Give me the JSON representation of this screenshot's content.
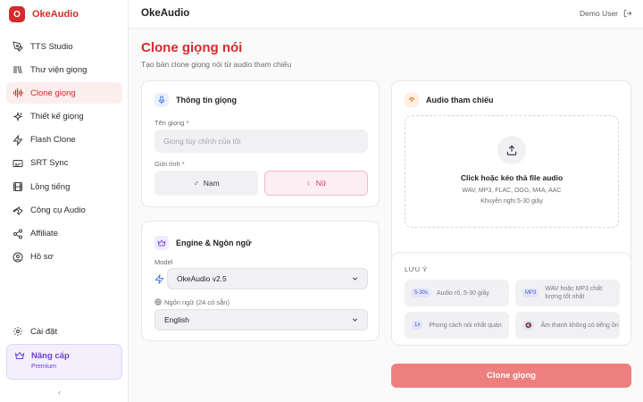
{
  "brand": {
    "logo_letter": "O",
    "name": "OkeAudio",
    "color": "#d42b2b"
  },
  "sidebar": {
    "items": [
      {
        "label": "TTS Studio",
        "icon": "pen-nib-icon"
      },
      {
        "label": "Thư viện giọng",
        "icon": "library-icon"
      },
      {
        "label": "Clone giọng",
        "icon": "waveform-icon",
        "active": true
      },
      {
        "label": "Thiết kế giọng",
        "icon": "sparkles-icon"
      },
      {
        "label": "Flash Clone",
        "icon": "lightning-icon"
      },
      {
        "label": "SRT Sync",
        "icon": "subtitles-icon"
      },
      {
        "label": "Lồng tiếng",
        "icon": "film-icon"
      },
      {
        "label": "Công cụ Audio",
        "icon": "wrench-icon"
      },
      {
        "label": "Affiliate",
        "icon": "share-icon"
      },
      {
        "label": "Hồ sơ",
        "icon": "user-circle-icon"
      }
    ],
    "settings_label": "Cài đặt",
    "upgrade": {
      "title": "Nâng cấp",
      "subtitle": "Premium"
    },
    "collapse_glyph": "‹"
  },
  "header": {
    "title": "OkeAudio",
    "user": "Demo User"
  },
  "page": {
    "title": "Clone giọng nói",
    "subtitle": "Tạo bản clone giọng nói từ audio tham chiếu"
  },
  "voice_info": {
    "title": "Thông tin giọng",
    "name_label": "Tên giọng *",
    "name_placeholder": "Giọng tùy chỉnh của tôi",
    "gender_label": "Giới tính *",
    "male": "Nam",
    "female": "Nữ"
  },
  "engine": {
    "title": "Engine & Ngôn ngữ",
    "model_label": "Model",
    "model_value": "OkeAudio v2.5",
    "language_label": "Ngôn ngữ (24 có sẵn)",
    "language_value": "English"
  },
  "reference": {
    "title": "Audio tham chiếu",
    "drop_title": "Click hoặc kéo thả file audio",
    "formats": "WAV, MP3, FLAC, OGG, M4A, AAC",
    "recommend": "Khuyến nghị 5-30 giây"
  },
  "notes": {
    "label": "LƯU Ý",
    "tips": [
      {
        "badge": "5-30s",
        "text": "Audio rõ, 5-30 giây"
      },
      {
        "badge": "MP3",
        "text": "WAV hoặc MP3 chất lượng tốt nhất"
      },
      {
        "badge": "1x",
        "text": "Phong cách nói nhất quán"
      },
      {
        "badge": "🔇",
        "text": "Âm thanh không có tiếng ồn"
      }
    ]
  },
  "actions": {
    "clone_label": "Clone giọng"
  },
  "colors": {
    "accent": "#d42b2b",
    "button": "#ee7f7f",
    "female_bg": "#fdeef4",
    "upgrade": "#6d3fd1"
  }
}
